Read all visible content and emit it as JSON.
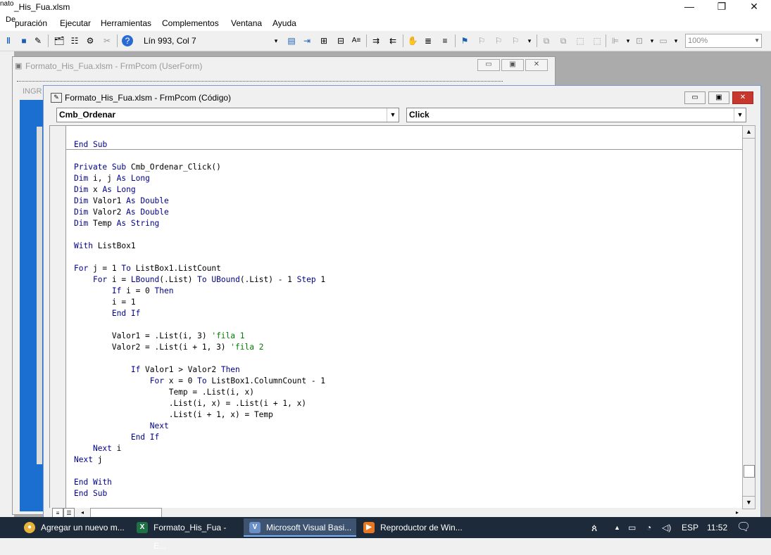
{
  "window": {
    "title_prefix": "nato",
    "title": "_His_Fua.xlsm",
    "minimize": "—",
    "restore": "❐",
    "close": "✕"
  },
  "menu": {
    "depuracion_cut": "De",
    "items": [
      "puración",
      "Ejecutar",
      "Herramientas",
      "Complementos",
      "Ventana",
      "Ayuda"
    ]
  },
  "toolbar": {
    "position": "Lín 993, Col 7",
    "zoom": "100%"
  },
  "userform_window": {
    "title": "Formato_His_Fua.xlsm - FrmPcom (UserForm)",
    "label_partial": "INGR"
  },
  "code_window": {
    "title": "Formato_His_Fua.xlsm - FrmPcom (Código)",
    "object_combo": "Cmb_Ordenar",
    "procedure_combo": "Click",
    "code_lines": [
      "End Sub",
      "",
      "Private Sub Cmb_Ordenar_Click()",
      "Dim i, j As Long",
      "Dim x As Long",
      "Dim Valor1 As Double",
      "Dim Valor2 As Double",
      "Dim Temp As String",
      "",
      "With ListBox1",
      "",
      "For j = 1 To ListBox1.ListCount",
      "    For i = LBound(.List) To UBound(.List) - 1 Step 1",
      "        If i = 0 Then",
      "        i = 1",
      "        End If",
      "",
      "        Valor1 = .List(i, 3) 'fila 1",
      "        Valor2 = .List(i + 1, 3) 'fila 2",
      "",
      "            If Valor1 > Valor2 Then",
      "                For x = 0 To ListBox1.ColumnCount - 1",
      "                    Temp = .List(i, x)",
      "                    .List(i, x) = .List(i + 1, x)",
      "                    .List(i + 1, x) = Temp",
      "                Next",
      "            End If",
      "    Next i",
      "Next j",
      "",
      "End With",
      "End Sub"
    ]
  },
  "taskbar": {
    "items": [
      {
        "label": "Agregar un nuevo m...",
        "icon": "chrome-icon",
        "color": "#e8b33a"
      },
      {
        "label": "Formato_His_Fua - E...",
        "icon": "excel-icon",
        "color": "#1e7145"
      },
      {
        "label": "Microsoft Visual Basi...",
        "icon": "vba-icon",
        "color": "#6a8ec7"
      },
      {
        "label": "Reproductor de Win...",
        "icon": "media-player-icon",
        "color": "#e87722"
      }
    ],
    "lang": "ESP",
    "time": "11:52"
  }
}
